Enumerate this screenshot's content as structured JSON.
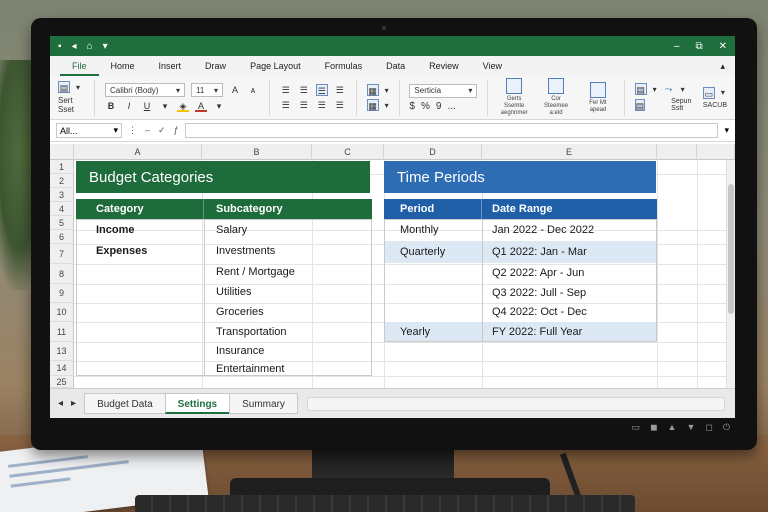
{
  "window": {
    "quick_access": [
      "▪",
      "◂",
      "⌂",
      "▾"
    ],
    "controls": [
      "–",
      "⧉",
      "✕"
    ]
  },
  "menu": {
    "tabs": [
      "File",
      "Home",
      "Insert",
      "Draw",
      "Page Layout",
      "Formulas",
      "Data",
      "Review",
      "View"
    ],
    "active_tab": "File",
    "pin": "▴"
  },
  "ribbon": {
    "clipboard_label": "Sert Sset",
    "font_name": "Calibri (Body)",
    "font_size": "11",
    "font_color": "#c0392b",
    "number_format": "Serticia",
    "number_symbols": [
      "$",
      "%",
      "9",
      "..."
    ],
    "group_captions": [
      "Gerts Ssemte aegnnmer",
      "Cor Steemee a:eld",
      "Fer Mt apead"
    ],
    "sort_label": "Sepun Sstt",
    "save_label": "SACUB"
  },
  "formula_bar": {
    "name_box": "All...",
    "value": ""
  },
  "columns": [
    "A",
    "B",
    "C",
    "D",
    "E"
  ],
  "rows": [
    "1",
    "2",
    "3",
    "4",
    "5",
    "6",
    "7",
    "8",
    "9",
    "10",
    "11",
    "13",
    "14",
    "25"
  ],
  "budget": {
    "title": "Budget Categories",
    "headers": [
      "Category",
      "Subcategory"
    ],
    "categories": [
      "Income",
      "Expenses"
    ],
    "subcategories": [
      "Salary",
      "Investments",
      "Rent / Mortgage",
      "Utilities",
      "Groceries",
      "Transportation",
      "Insurance",
      "Entertainment"
    ]
  },
  "time": {
    "title": "Time Periods",
    "headers": [
      "Period",
      "Date Range"
    ],
    "periods": [
      "Monthly",
      "Quarterly",
      "Yearly"
    ],
    "ranges": [
      "Jan 2022 - Dec 2022",
      "Q1 2022:  Jan - Mar",
      "Q2 2022:  Apr - Jun",
      "Q3 2022:  Jull - Sep",
      "Q4 2022:  Oct - Dec",
      "FY 2022:  Full Year"
    ]
  },
  "sheet_tabs": {
    "nav": [
      "◂",
      "▸"
    ],
    "tabs": [
      "Budget Data",
      "Settings",
      "Summary"
    ],
    "active": "Settings"
  },
  "colors": {
    "green": "#1e6b3c",
    "blue": "#2e6db4",
    "blue_header": "#1f5fa8",
    "title_bar": "#1e6e3e"
  }
}
